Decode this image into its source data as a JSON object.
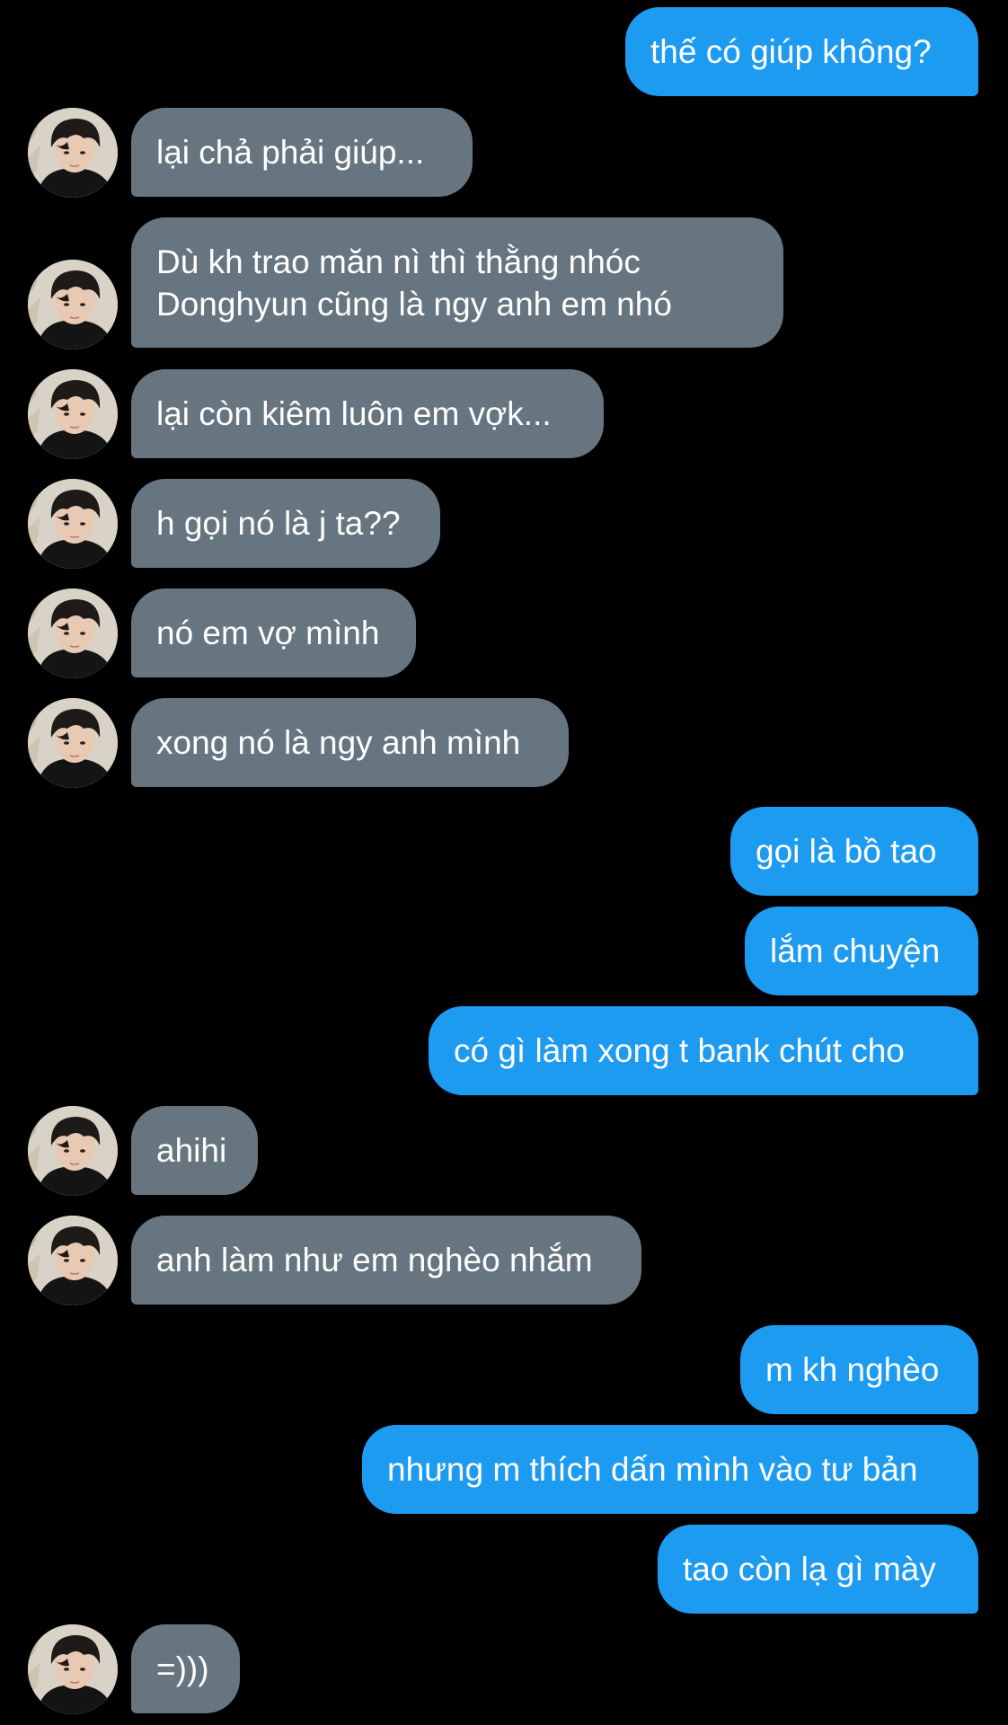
{
  "conversation": {
    "colors": {
      "background": "#000000",
      "outgoing_bubble": "#1d9bf0",
      "incoming_bubble": "#66757f",
      "text": "#ffffff"
    },
    "contact_avatar_icon": "user-avatar-photo",
    "messages": [
      {
        "dir": "out",
        "text": "thế có giúp không?"
      },
      {
        "dir": "in",
        "text": "lại chả phải giúp..."
      },
      {
        "dir": "in",
        "lines": [
          "Dù kh trao măn nì thì thằng nhóc",
          "Donghyun cũng là ngy anh em nhó"
        ]
      },
      {
        "dir": "in",
        "text": "lại còn kiêm luôn em vợk..."
      },
      {
        "dir": "in",
        "text": "h gọi nó là j ta??"
      },
      {
        "dir": "in",
        "text": "nó em vợ mình"
      },
      {
        "dir": "in",
        "text": "xong nó là ngy anh mình"
      },
      {
        "dir": "out",
        "text": "gọi là bồ tao"
      },
      {
        "dir": "out",
        "text": "lắm chuyện"
      },
      {
        "dir": "out",
        "text": "có gì làm xong t bank chút cho"
      },
      {
        "dir": "in",
        "text": "ahihi"
      },
      {
        "dir": "in",
        "text": "anh làm như em nghèo nhắm"
      },
      {
        "dir": "out",
        "text": "m kh nghèo"
      },
      {
        "dir": "out",
        "text": "nhưng m thích dấn mình vào tư bản"
      },
      {
        "dir": "out",
        "text": "tao còn lạ gì mày"
      },
      {
        "dir": "in",
        "text": "=)))"
      }
    ]
  }
}
